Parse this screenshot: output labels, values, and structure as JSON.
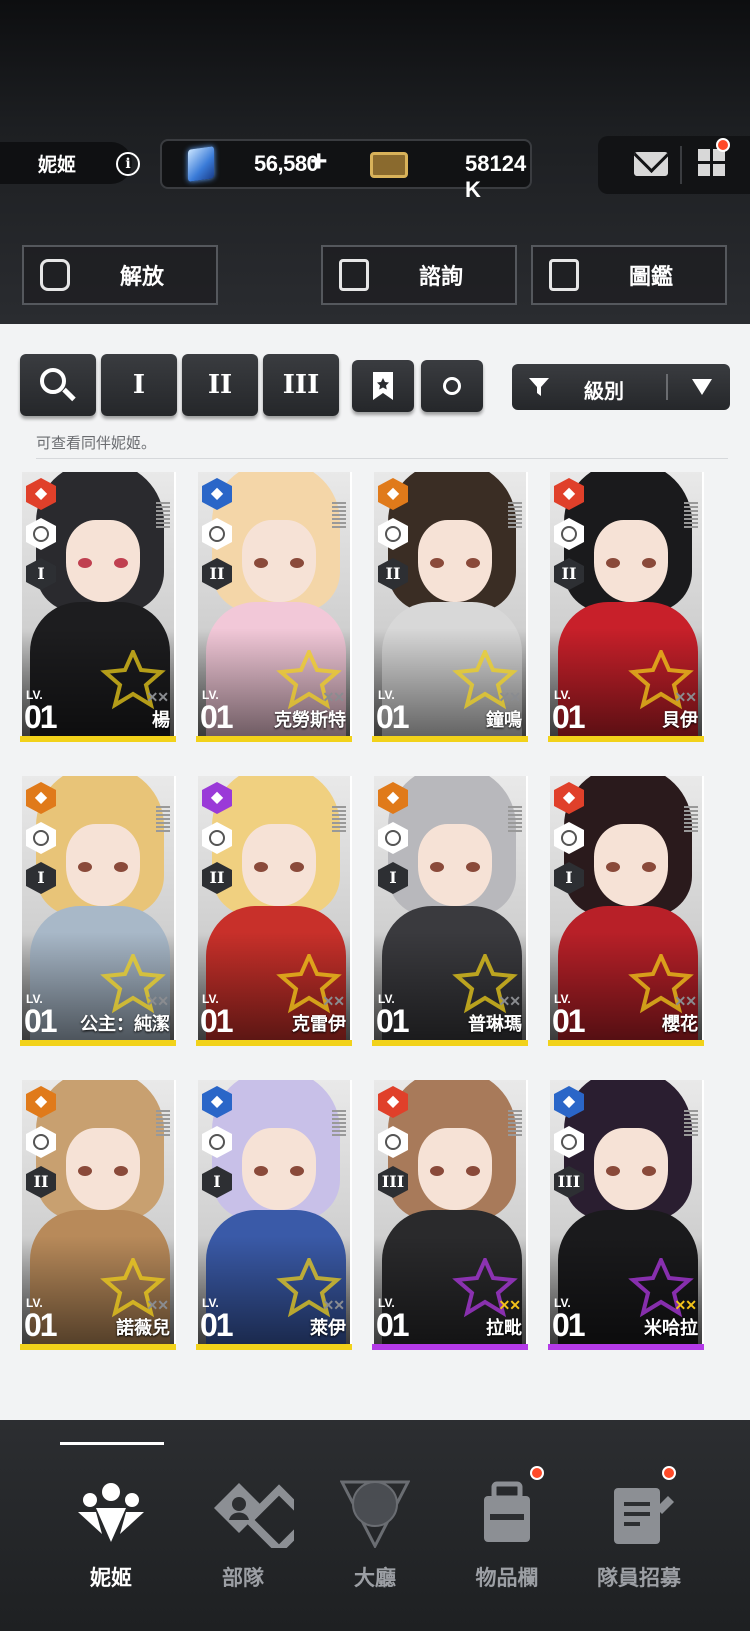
{
  "header": {
    "section_name": "妮姬",
    "info_icon": "i",
    "gems": "56,580",
    "gems_plus": "+",
    "tickets": "58124 K"
  },
  "top_buttons": [
    {
      "label": "解放",
      "icon": "unlock-icon"
    },
    {
      "label": "諮詢",
      "icon": "calendar-icon"
    },
    {
      "label": "圖鑑",
      "icon": "codex-icon"
    }
  ],
  "filters": {
    "burst_1": "I",
    "burst_2": "II",
    "burst_3": "III",
    "sort_label": "級別"
  },
  "hint": "可查看同伴妮姬。",
  "level_label": "LV.",
  "characters": [
    {
      "name": "楊",
      "level": "01",
      "burst": "I",
      "element": "#e0402a",
      "rarity": "gold",
      "hair": "#2a2a2e",
      "outfit": "#1d1d1f"
    },
    {
      "name": "克勞斯特",
      "level": "01",
      "burst": "II",
      "element": "#2a66c8",
      "rarity": "gold",
      "hair": "#f4d6a8",
      "outfit": "#f2c8d8"
    },
    {
      "name": "鐘鳴",
      "level": "01",
      "burst": "II",
      "element": "#e07a1a",
      "rarity": "gold",
      "hair": "#3a2d24",
      "outfit": "#d8d8d8"
    },
    {
      "name": "貝伊",
      "level": "01",
      "burst": "II",
      "element": "#e0402a",
      "rarity": "gold",
      "hair": "#1a1a1c",
      "outfit": "#c8202a"
    },
    {
      "name": "公主：純潔",
      "level": "01",
      "burst": "I",
      "element": "#e07a1a",
      "rarity": "gold",
      "hair": "#e8c478",
      "outfit": "#a8b8c8"
    },
    {
      "name": "克雷伊",
      "level": "01",
      "burst": "II",
      "element": "#9a3ad8",
      "rarity": "gold",
      "hair": "#f0d080",
      "outfit": "#c8302a"
    },
    {
      "name": "普琳瑪",
      "level": "01",
      "burst": "I",
      "element": "#e07a1a",
      "rarity": "gold",
      "hair": "#b8b8bc",
      "outfit": "#3a3a3e"
    },
    {
      "name": "櫻花",
      "level": "01",
      "burst": "I",
      "element": "#e0402a",
      "rarity": "gold",
      "hair": "#2a1a1c",
      "outfit": "#b82028"
    },
    {
      "name": "諾薇兒",
      "level": "01",
      "burst": "II",
      "element": "#e07a1a",
      "rarity": "gold",
      "hair": "#c8a070",
      "outfit": "#b88a5a"
    },
    {
      "name": "萊伊",
      "level": "01",
      "burst": "I",
      "element": "#2a66c8",
      "rarity": "gold",
      "hair": "#c8c0e8",
      "outfit": "#3a5aa8"
    },
    {
      "name": "拉毗",
      "level": "01",
      "burst": "III",
      "element": "#e0402a",
      "rarity": "purple",
      "hair": "#a87a5a",
      "outfit": "#2a2a2c"
    },
    {
      "name": "米哈拉",
      "level": "01",
      "burst": "III",
      "element": "#2a66c8",
      "rarity": "purple",
      "hair": "#2a1e30",
      "outfit": "#1a1a1c"
    }
  ],
  "nav": [
    {
      "label": "妮姬",
      "icon": "nikke-icon",
      "active": true
    },
    {
      "label": "部隊",
      "icon": "squad-icon",
      "active": false
    },
    {
      "label": "大廳",
      "icon": "lobby-icon",
      "active": false
    },
    {
      "label": "物品欄",
      "icon": "inventory-icon",
      "active": false
    },
    {
      "label": "隊員招募",
      "icon": "recruit-icon",
      "active": false
    }
  ],
  "colors": {
    "gold_bar": "#f2d21a",
    "purple_bar": "#b43ae8",
    "notification": "#ff4a28"
  }
}
